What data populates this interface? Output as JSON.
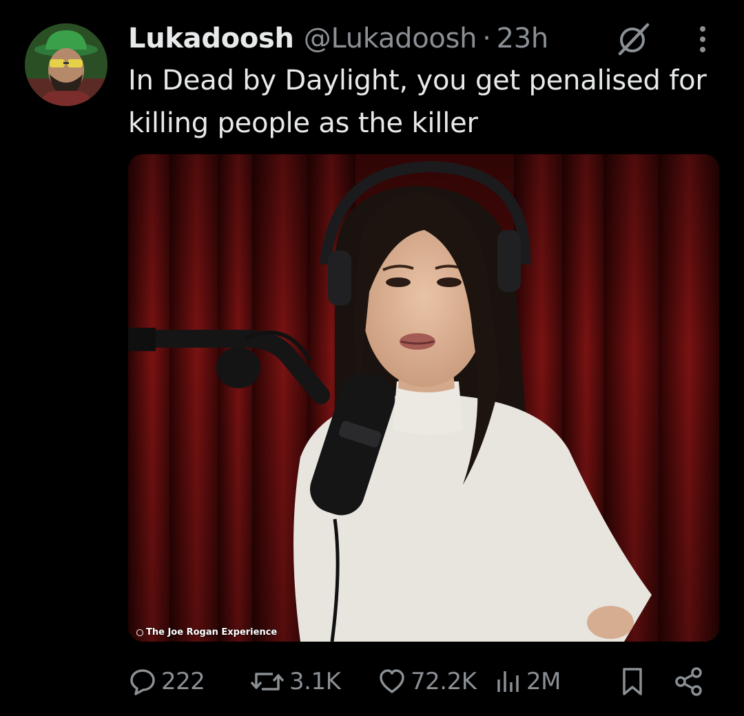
{
  "tweet": {
    "display_name": "Lukadoosh",
    "handle": "@Lukadoosh",
    "separator": "·",
    "time": "23h",
    "text": "In Dead by Daylight, you get penalised for killing people as the killer",
    "media": {
      "watermark": "The Joe Rogan Experience"
    },
    "stats": {
      "replies": "222",
      "reposts": "3.1K",
      "likes": "72.2K",
      "views": "2M"
    }
  },
  "colors": {
    "background": "#000000",
    "text_primary": "#e7e9ea",
    "text_secondary": "#8b9095",
    "curtain": "#5a0b0b"
  },
  "icons": {
    "reply": "speech-bubble-icon",
    "repost": "repost-arrows-icon",
    "like": "heart-icon",
    "views": "bar-chart-icon",
    "bookmark": "bookmark-icon",
    "share": "share-icon",
    "grok": "grok-icon",
    "more": "more-vertical-icon"
  }
}
